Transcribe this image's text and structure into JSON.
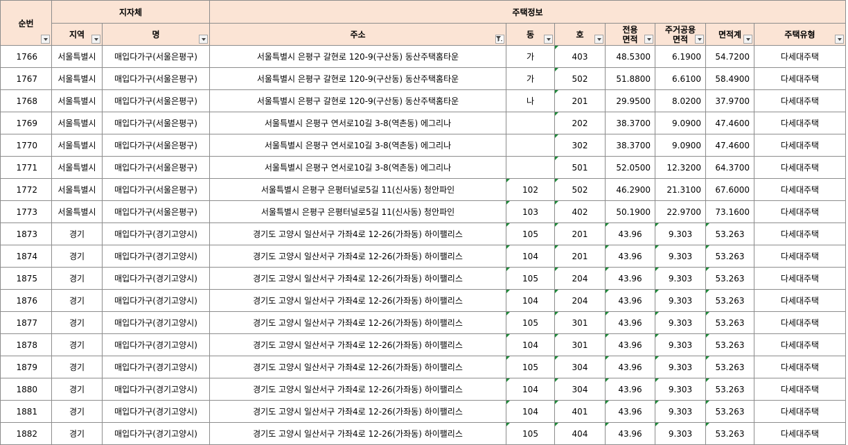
{
  "header": {
    "seq": "순번",
    "group_branch": "지자체",
    "group_house": "주택정보",
    "region": "지역",
    "name": "명",
    "address": "주소",
    "dong": "동",
    "ho": "호",
    "exclusive_area_1": "전용",
    "exclusive_area_2": "면적",
    "common_area_1": "주거공용",
    "common_area_2": "면적",
    "total_area": "면적계",
    "type": "주택유형"
  },
  "rows": [
    {
      "seq": "1766",
      "region": "서울특별시",
      "name": "매입다가구(서울은평구)",
      "address": "서울특별시 은평구 갈현로 120-9(구산동) 동산주택홈타운",
      "dong": "가",
      "ho": "403",
      "excl": "48.5300",
      "common": "6.1900",
      "total": "54.7200",
      "type": "다세대주택"
    },
    {
      "seq": "1767",
      "region": "서울특별시",
      "name": "매입다가구(서울은평구)",
      "address": "서울특별시 은평구 갈현로 120-9(구산동) 동산주택홈타운",
      "dong": "가",
      "ho": "502",
      "excl": "51.8800",
      "common": "6.6100",
      "total": "58.4900",
      "type": "다세대주택"
    },
    {
      "seq": "1768",
      "region": "서울특별시",
      "name": "매입다가구(서울은평구)",
      "address": "서울특별시 은평구 갈현로 120-9(구산동) 동산주택홈타운",
      "dong": "나",
      "ho": "201",
      "excl": "29.9500",
      "common": "8.0200",
      "total": "37.9700",
      "type": "다세대주택"
    },
    {
      "seq": "1769",
      "region": "서울특별시",
      "name": "매입다가구(서울은평구)",
      "address": "서울특별시 은평구 연서로10길 3-8(역촌동) 에그리나",
      "dong": "",
      "ho": "202",
      "excl": "38.3700",
      "common": "9.0900",
      "total": "47.4600",
      "type": "다세대주택"
    },
    {
      "seq": "1770",
      "region": "서울특별시",
      "name": "매입다가구(서울은평구)",
      "address": "서울특별시 은평구 연서로10길 3-8(역촌동) 에그리나",
      "dong": "",
      "ho": "302",
      "excl": "38.3700",
      "common": "9.0900",
      "total": "47.4600",
      "type": "다세대주택"
    },
    {
      "seq": "1771",
      "region": "서울특별시",
      "name": "매입다가구(서울은평구)",
      "address": "서울특별시 은평구 연서로10길 3-8(역촌동) 에그리나",
      "dong": "",
      "ho": "501",
      "excl": "52.0500",
      "common": "12.3200",
      "total": "64.3700",
      "type": "다세대주택"
    },
    {
      "seq": "1772",
      "region": "서울특별시",
      "name": "매입다가구(서울은평구)",
      "address": "서울특별시 은평구 은평터널로5길 11(신사동) 청안파인",
      "dong": "102",
      "ho": "502",
      "excl": "46.2900",
      "common": "21.3100",
      "total": "67.6000",
      "type": "다세대주택"
    },
    {
      "seq": "1773",
      "region": "서울특별시",
      "name": "매입다가구(서울은평구)",
      "address": "서울특별시 은평구 은평터널로5길 11(신사동) 청안파인",
      "dong": "103",
      "ho": "402",
      "excl": "50.1900",
      "common": "22.9700",
      "total": "73.1600",
      "type": "다세대주택"
    },
    {
      "seq": "1873",
      "region": "경기",
      "name": "매입다가구(경기고양시)",
      "address": "경기도 고양시 일산서구 가좌4로 12-26(가좌동) 하이팰리스",
      "dong": "105",
      "ho": "201",
      "excl": "43.96",
      "common": "9.303",
      "total": "53.263",
      "type": "다세대주택"
    },
    {
      "seq": "1874",
      "region": "경기",
      "name": "매입다가구(경기고양시)",
      "address": "경기도 고양시 일산서구 가좌4로 12-26(가좌동) 하이팰리스",
      "dong": "104",
      "ho": "201",
      "excl": "43.96",
      "common": "9.303",
      "total": "53.263",
      "type": "다세대주택"
    },
    {
      "seq": "1875",
      "region": "경기",
      "name": "매입다가구(경기고양시)",
      "address": "경기도 고양시 일산서구 가좌4로 12-26(가좌동) 하이팰리스",
      "dong": "105",
      "ho": "204",
      "excl": "43.96",
      "common": "9.303",
      "total": "53.263",
      "type": "다세대주택"
    },
    {
      "seq": "1876",
      "region": "경기",
      "name": "매입다가구(경기고양시)",
      "address": "경기도 고양시 일산서구 가좌4로 12-26(가좌동) 하이팰리스",
      "dong": "104",
      "ho": "204",
      "excl": "43.96",
      "common": "9.303",
      "total": "53.263",
      "type": "다세대주택"
    },
    {
      "seq": "1877",
      "region": "경기",
      "name": "매입다가구(경기고양시)",
      "address": "경기도 고양시 일산서구 가좌4로 12-26(가좌동) 하이팰리스",
      "dong": "105",
      "ho": "301",
      "excl": "43.96",
      "common": "9.303",
      "total": "53.263",
      "type": "다세대주택"
    },
    {
      "seq": "1878",
      "region": "경기",
      "name": "매입다가구(경기고양시)",
      "address": "경기도 고양시 일산서구 가좌4로 12-26(가좌동) 하이팰리스",
      "dong": "104",
      "ho": "301",
      "excl": "43.96",
      "common": "9.303",
      "total": "53.263",
      "type": "다세대주택"
    },
    {
      "seq": "1879",
      "region": "경기",
      "name": "매입다가구(경기고양시)",
      "address": "경기도 고양시 일산서구 가좌4로 12-26(가좌동) 하이팰리스",
      "dong": "105",
      "ho": "304",
      "excl": "43.96",
      "common": "9.303",
      "total": "53.263",
      "type": "다세대주택"
    },
    {
      "seq": "1880",
      "region": "경기",
      "name": "매입다가구(경기고양시)",
      "address": "경기도 고양시 일산서구 가좌4로 12-26(가좌동) 하이팰리스",
      "dong": "104",
      "ho": "304",
      "excl": "43.96",
      "common": "9.303",
      "total": "53.263",
      "type": "다세대주택"
    },
    {
      "seq": "1881",
      "region": "경기",
      "name": "매입다가구(경기고양시)",
      "address": "경기도 고양시 일산서구 가좌4로 12-26(가좌동) 하이팰리스",
      "dong": "104",
      "ho": "401",
      "excl": "43.96",
      "common": "9.303",
      "total": "53.263",
      "type": "다세대주택"
    },
    {
      "seq": "1882",
      "region": "경기",
      "name": "매입다가구(경기고양시)",
      "address": "경기도 고양시 일산서구 가좌4로 12-26(가좌동) 하이팰리스",
      "dong": "105",
      "ho": "404",
      "excl": "43.96",
      "common": "9.303",
      "total": "53.263",
      "type": "다세대주택"
    }
  ],
  "style": {
    "header_bg": "#fbe4d5",
    "grid_color": "#8c8c8c",
    "text_marker_color": "#1f8a3a"
  },
  "icons": {
    "filter_dropdown": "chevron-down-icon",
    "active_filter": "filter-funnel-icon"
  }
}
